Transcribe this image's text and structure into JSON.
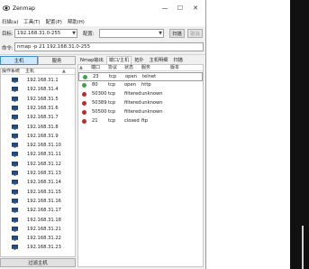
{
  "window": {
    "title": "Zenmap",
    "controls": {
      "minimize": "—",
      "maximize": "☐",
      "close": "✕"
    }
  },
  "menu": [
    "扫描(a)",
    "工具(T)",
    "配置(P)",
    "帮助(H)"
  ],
  "toolbar": {
    "target_label": "目标:",
    "target_value": "192.168.31.0-255",
    "profile_label": "配置:",
    "profile_value": "",
    "scan_button": "扫描",
    "cancel_button": "取消"
  },
  "command": {
    "label": "命令:",
    "value": "nmap -p 21 192.168.31.0-255"
  },
  "left_tabs": {
    "hosts": "主机",
    "services": "服务"
  },
  "host_list": {
    "headers": [
      "操作系统",
      "主机"
    ],
    "hosts": [
      "192.168.31.1",
      "192.168.31.4",
      "192.168.31.5",
      "192.168.31.6",
      "192.168.31.7",
      "192.168.31.8",
      "192.168.31.9",
      "192.168.31.10",
      "192.168.31.11",
      "192.168.31.12",
      "192.168.31.13",
      "192.168.31.14",
      "192.168.31.15",
      "192.168.31.16",
      "192.168.31.17",
      "192.168.31.18",
      "192.168.31.21",
      "192.168.31.22",
      "192.168.31.23"
    ],
    "filter_button": "过滤主机"
  },
  "right_tabs": [
    "Nmap输出",
    "端口/主机",
    "拓扑",
    "主机明细",
    "扫描"
  ],
  "ports": {
    "headers": [
      "端口",
      "协议",
      "状态",
      "服务",
      "版本"
    ],
    "rows": [
      {
        "port": "23",
        "proto": "tcp",
        "state": "open",
        "service": "telnet",
        "status": "open"
      },
      {
        "port": "80",
        "proto": "tcp",
        "state": "open",
        "service": "http",
        "status": "open"
      },
      {
        "port": "50300",
        "proto": "tcp",
        "state": "filtered",
        "service": "unknown",
        "status": "closed"
      },
      {
        "port": "50389",
        "proto": "tcp",
        "state": "filtered",
        "service": "unknown",
        "status": "closed"
      },
      {
        "port": "50500",
        "proto": "tcp",
        "state": "filtered",
        "service": "unknown",
        "status": "closed"
      },
      {
        "port": "21",
        "proto": "tcp",
        "state": "closed",
        "service": "ftp",
        "status": "closed"
      }
    ]
  },
  "colors": {
    "open": "#3fa33f",
    "closed": "#c62828",
    "selected_tab": "#cde8ff",
    "os_icon": "#1f4e8c"
  },
  "icons": {
    "app": "zenmap-eye-icon",
    "os": "monitor-icon"
  }
}
